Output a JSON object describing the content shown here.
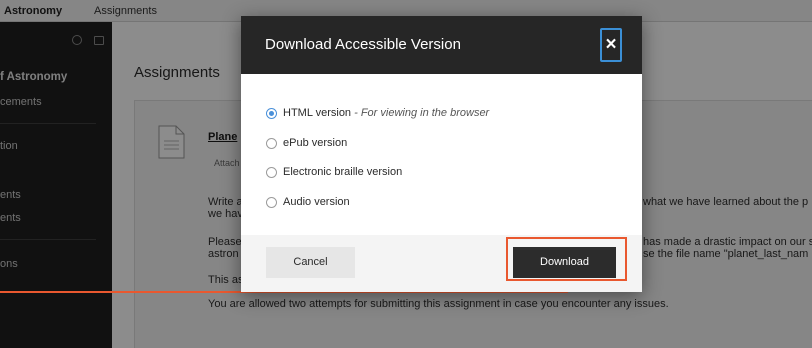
{
  "app": {
    "course_name": "Astronomy",
    "breadcrumb": "Assignments"
  },
  "sidebar": {
    "course_title": "f Astronomy",
    "items": [
      {
        "label": "cements"
      },
      {
        "label": "tion"
      },
      {
        "label": "ents"
      },
      {
        "label": "ents"
      },
      {
        "label": "ons"
      }
    ]
  },
  "main": {
    "title": "Assignments",
    "assignment_link": "Plane",
    "attach_label": "Attach",
    "text_lines": [
      "Write a",
      "we hav",
      "Please",
      "astron",
      "This as",
      "You are allowed two attempts for submitting this assignment in case you encounter any issues."
    ],
    "right_lines": [
      "what we have learned about the p",
      "has made a drastic impact on our s",
      "se the file name \"planet_last_nam"
    ]
  },
  "modal": {
    "title": "Download Accessible Version",
    "close_label": "×",
    "options": [
      {
        "label": "HTML version",
        "description": " - For viewing in the browser",
        "checked": true
      },
      {
        "label": "ePub version",
        "description": "",
        "checked": false
      },
      {
        "label": "Electronic braille version",
        "description": "",
        "checked": false
      },
      {
        "label": "Audio version",
        "description": "",
        "checked": false
      }
    ],
    "cancel_label": "Cancel",
    "download_label": "Download"
  },
  "colors": {
    "header_bg": "#262626",
    "focus_ring": "#3b8fd6",
    "radio_selected": "#4a90d9",
    "highlight": "#e9582f"
  }
}
